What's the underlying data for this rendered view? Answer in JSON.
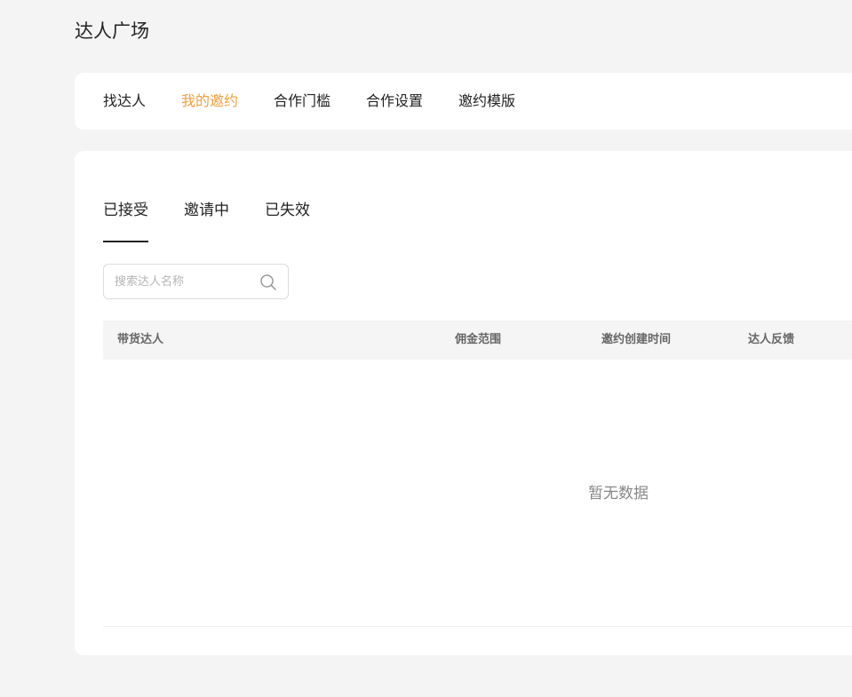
{
  "page": {
    "title": "达人广场"
  },
  "nav": {
    "tabs": [
      {
        "label": "找达人",
        "active": false
      },
      {
        "label": "我的邀约",
        "active": true
      },
      {
        "label": "合作门槛",
        "active": false
      },
      {
        "label": "合作设置",
        "active": false
      },
      {
        "label": "邀约模版",
        "active": false
      }
    ],
    "active_color": "#f0a040"
  },
  "sub_tabs": [
    {
      "label": "已接受",
      "active": true
    },
    {
      "label": "邀请中",
      "active": false
    },
    {
      "label": "已失效",
      "active": false
    }
  ],
  "search": {
    "placeholder": "搜索达人名称",
    "value": ""
  },
  "table": {
    "columns": [
      "带货达人",
      "佣金范围",
      "邀约创建时间",
      "达人反馈"
    ],
    "rows": [],
    "empty_text": "暂无数据"
  }
}
